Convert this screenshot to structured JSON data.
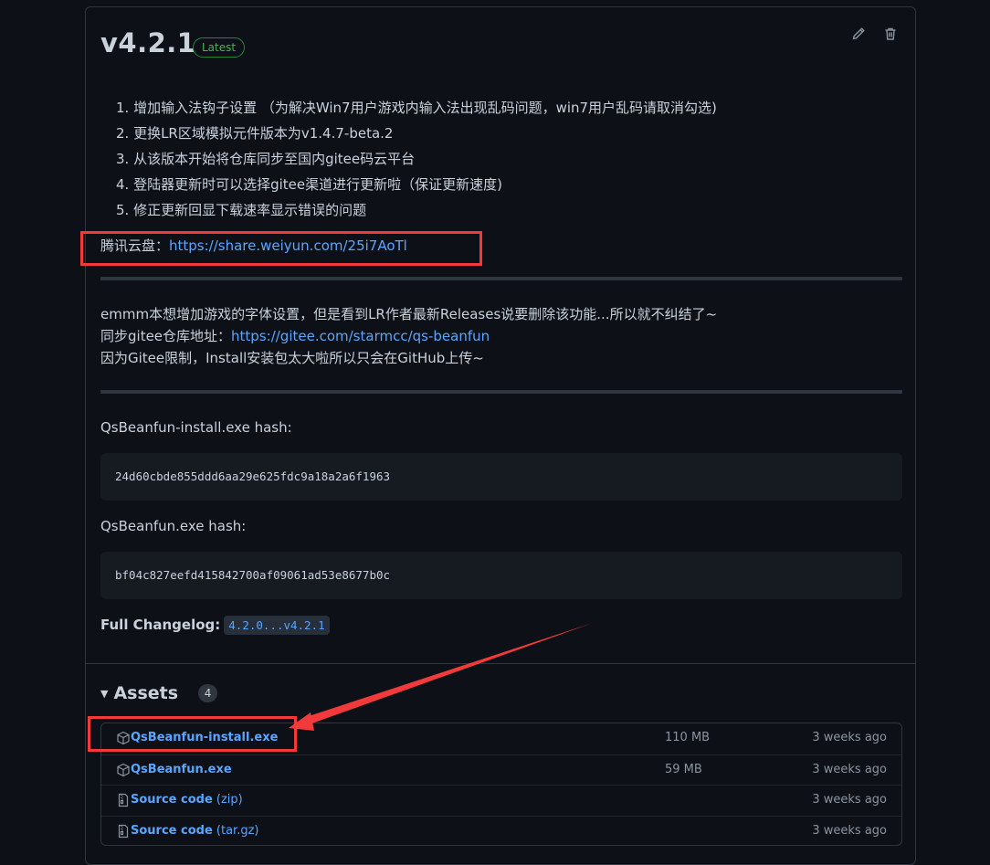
{
  "release": {
    "version": "v4.2.1",
    "badge": "Latest",
    "edit_icon": "pencil-icon",
    "delete_icon": "trash-icon"
  },
  "notes": [
    "1. 增加输入法钩子设置 （为解决Win7用户游戏内输入法出现乱码问题，win7用户乱码请取消勾选)",
    "2. 更换LR区域模拟元件版本为v1.4.7-beta.2",
    "3. 从该版本开始将仓库同步至国内gitee码云平台",
    "4. 登陆器更新时可以选择gitee渠道进行更新啦（保证更新速度)",
    "5. 修正更新回显下载速率显示错误的问题"
  ],
  "weiyun": {
    "label": "腾讯云盘：",
    "url": "https://share.weiyun.com/25i7AoTl"
  },
  "paragraph": {
    "line1": "emmm本想增加游戏的字体设置，但是看到LR作者最新Releases说要删除该功能...所以就不纠结了~",
    "line2_label": "同步gitee仓库地址：",
    "line2_url": "https://gitee.com/starmcc/qs-beanfun",
    "line3": "因为Gitee限制，Install安装包太大啦所以只会在GitHub上传~"
  },
  "hashes": [
    {
      "label": "QsBeanfun-install.exe hash:",
      "value": "24d60cbde855ddd6aa29e625fdc9a18a2a6f1963"
    },
    {
      "label": "QsBeanfun.exe hash:",
      "value": "bf04c827eefd415842700af09061ad53e8677b0c"
    }
  ],
  "changelog": {
    "label": "Full Changelog:",
    "range": "4.2.0...v4.2.1"
  },
  "assets": {
    "title": "Assets",
    "count": "4",
    "items": [
      {
        "name": "QsBeanfun-install.exe",
        "suffix": "",
        "size": "110 MB",
        "time": "3 weeks ago",
        "icon": "package-icon"
      },
      {
        "name": "QsBeanfun.exe",
        "suffix": "",
        "size": "59 MB",
        "time": "3 weeks ago",
        "icon": "package-icon"
      },
      {
        "name": "Source code",
        "suffix": " (zip)",
        "size": "",
        "time": "3 weeks ago",
        "icon": "file-zip-icon"
      },
      {
        "name": "Source code",
        "suffix": " (tar.gz)",
        "size": "",
        "time": "3 weeks ago",
        "icon": "file-zip-icon"
      }
    ]
  },
  "colors": {
    "background": "#0d1117",
    "link": "#58a6ff",
    "badge_green": "#3fb950",
    "annotation_red": "#f23a3a"
  }
}
